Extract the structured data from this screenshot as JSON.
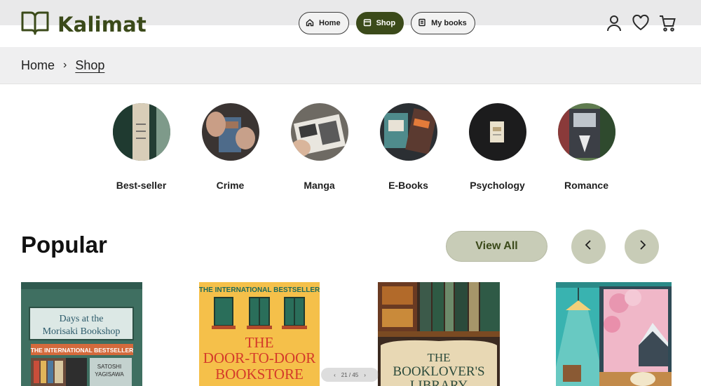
{
  "brand": {
    "name": "Kalimat",
    "accent": "#3b4a1a",
    "soft_accent": "#c8ccb7"
  },
  "nav": [
    {
      "label": "Home",
      "icon": "home-icon",
      "active": false
    },
    {
      "label": "Shop",
      "icon": "shop-icon",
      "active": true
    },
    {
      "label": "My books",
      "icon": "book-icon",
      "active": false
    }
  ],
  "header_icons": [
    "user-icon",
    "heart-icon",
    "cart-icon"
  ],
  "breadcrumb": {
    "home": "Home",
    "separator": "›",
    "current": "Shop"
  },
  "categories": [
    {
      "label": "Best-seller"
    },
    {
      "label": "Crime"
    },
    {
      "label": "Manga"
    },
    {
      "label": "E-Books"
    },
    {
      "label": "Psychology"
    },
    {
      "label": "Romance"
    }
  ],
  "popular": {
    "title": "Popular",
    "view_all": "View All",
    "prev_icon": "chevron-left-icon",
    "next_icon": "chevron-right-icon"
  },
  "books": [
    {
      "title_line1": "Days at the",
      "title_line2": "Morisaki Bookshop",
      "banner": "THE INTERNATIONAL BESTSELLER",
      "author_line1": "SATOSHI",
      "author_line2": "YAGISAWA"
    },
    {
      "banner": "THE INTERNATIONAL BESTSELLER",
      "title_line1": "THE",
      "title_line2": "DOOR-TO-DOOR",
      "title_line3": "BOOKSTORE"
    },
    {
      "title_line1": "THE",
      "title_line2": "BOOKLOVER'S",
      "title_line3": "LIBRARY"
    },
    {}
  ],
  "pager": {
    "text": "21 / 45"
  }
}
